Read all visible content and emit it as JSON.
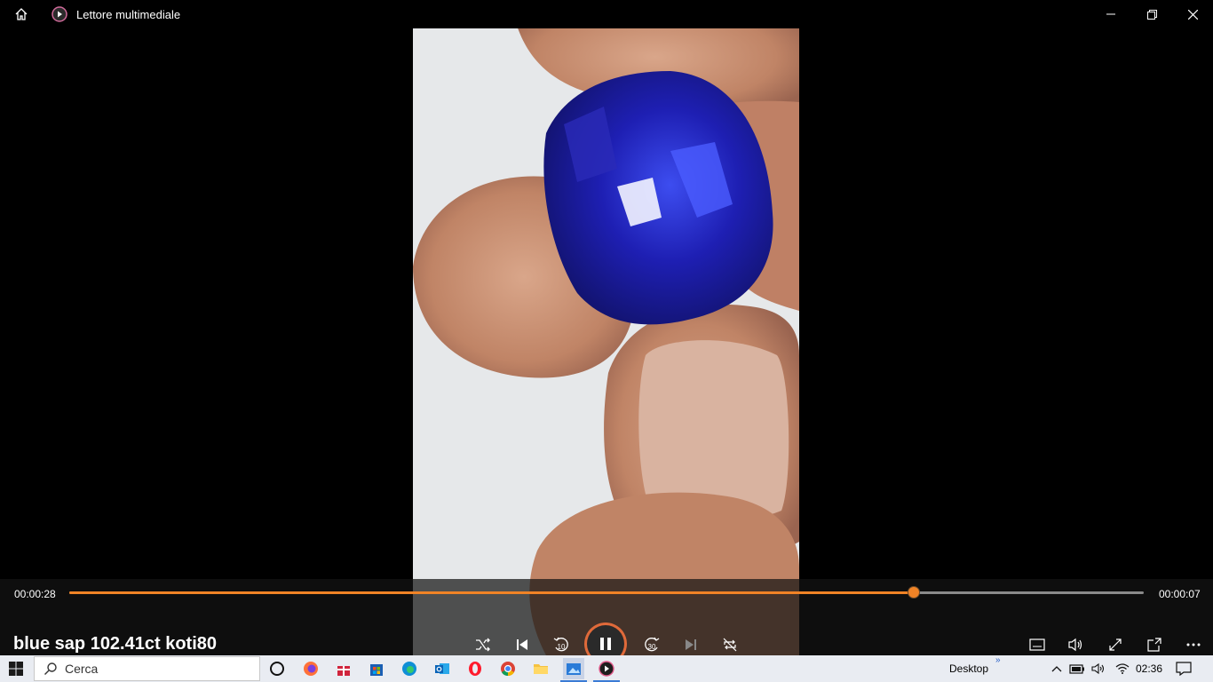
{
  "window": {
    "title": "Lettore multimediale"
  },
  "player": {
    "elapsed": "00:00:28",
    "remaining": "00:00:07",
    "progress": 0.786,
    "media_title": "blue sap 102.41ct koti80",
    "colors": {
      "accent": "#f08326",
      "play_ring": "#e06a3a"
    }
  },
  "controls": {
    "skip_back": "10",
    "skip_forward": "30"
  },
  "taskbar": {
    "search_placeholder": "Cerca",
    "desktop_label": "Desktop",
    "clock": "02:36",
    "apps": [
      "task-view",
      "firefox",
      "gift",
      "store",
      "edge",
      "outlook",
      "opera",
      "chrome",
      "file-explorer",
      "photos",
      "media-player"
    ]
  }
}
